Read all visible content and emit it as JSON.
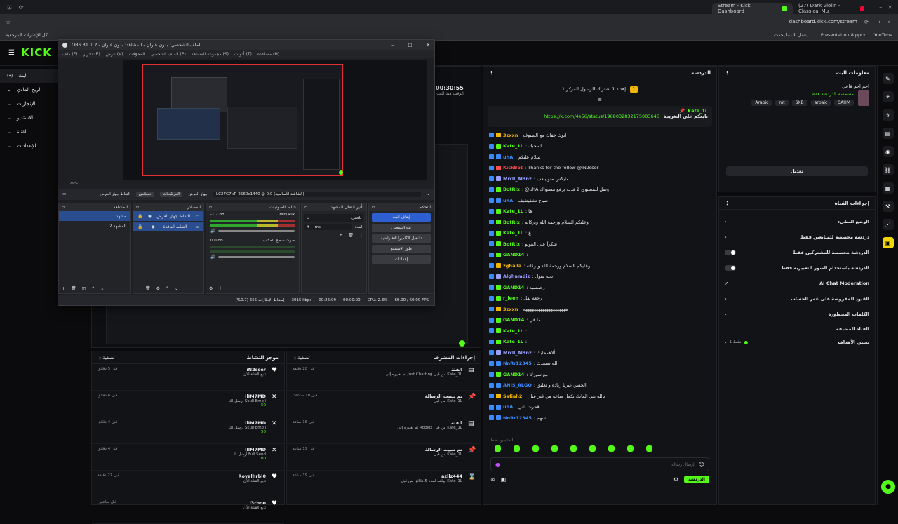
{
  "browser": {
    "tabs": [
      {
        "label": "Stream - Kick Dashboard",
        "active": true
      },
      {
        "label": "(27) Dark Violin - Classical Mu",
        "active": false
      }
    ],
    "url": "dashboard.kick.com/stream",
    "bookmarks": [
      "كل الإشارات المرجعية",
      "ينتقل لك ما يحدث...",
      "Presentation 8.pptx",
      "YouTube"
    ]
  },
  "kick": {
    "logo": "KICK",
    "nav": [
      {
        "label": "البث",
        "icon": "(•)",
        "active": true
      },
      {
        "label": "الربح المادي",
        "icon": "$"
      },
      {
        "label": "الإنجازات",
        "icon": "🏆"
      },
      {
        "label": "الاستديو",
        "icon": "✎"
      },
      {
        "label": "القناة",
        "icon": "✉"
      },
      {
        "label": "الإعدادات",
        "icon": "⚙"
      }
    ],
    "stream_timer": "00:30:55",
    "stream_timer_label": "الوقت منذ البث",
    "chat": {
      "title": "الدردشة",
      "pinned_banner": "إهداء 1 اشتراك للرسول المركز 1 ",
      "pinned_by": "Kate_1L",
      "pinned_text": "تابعكم على التغريدة",
      "pinned_link": "https://x.com/4e56/status/1968032832175083646",
      "messages": [
        {
          "user": "3zxxn",
          "color": "#f2b705",
          "text": ": ابوك خفاك مع الضيوف"
        },
        {
          "user": "Kate_1L",
          "color": "#53fc18",
          "text": ": اسحبك"
        },
        {
          "user": "uhA",
          "color": "#3a8bff",
          "text": ": سلام عليكم"
        },
        {
          "user": "KickBot",
          "color": "#ff4d4d",
          "text": ": Thanks for the follow @iN2sser"
        },
        {
          "user": "Mixll_Al3nz",
          "color": "#9aa0ff",
          "text": ": مايكس منو يلعب"
        },
        {
          "user": "BotRix",
          "color": "#53fc18",
          "text": ": @uhA وصل للمستوى 2 قدت برفع مستواك"
        },
        {
          "user": "uhA",
          "color": "#3a8bff",
          "text": ": صباح تشقيتقيف"
        },
        {
          "user": "Kate_1L",
          "color": "#53fc18",
          "text": ": ها"
        },
        {
          "user": "BotRix",
          "color": "#53fc18",
          "text": ": وعليكم السلام ورحمة الله وبركاته"
        },
        {
          "user": "Kate_1L",
          "color": "#53fc18",
          "text": ": غ!"
        },
        {
          "user": "BotRix",
          "color": "#53fc18",
          "text": ": شكراً على الفولو"
        },
        {
          "user": "GAND14",
          "color": "#53fc18",
          "text": ":"
        },
        {
          "user": "zghalla",
          "color": "#f2b705",
          "text": ": وعليكم السلام ورحمة الله وبركاته"
        },
        {
          "user": "Alghamdiz",
          "color": "#9aa0ff",
          "text": ": دنيه يقول"
        },
        {
          "user": "GAND14",
          "color": "#53fc18",
          "text": ": رحمسيه"
        },
        {
          "user": "r_leen",
          "color": "#53fc18",
          "text": ": رجعه يقل"
        },
        {
          "user": "3zxxn",
          "color": "#f2b705",
          "text": ": ههههههههههههههههههههه"
        },
        {
          "user": "GAND14",
          "color": "#53fc18",
          "text": ": ما في"
        },
        {
          "user": "Kate_1L",
          "color": "#53fc18",
          "text": ":"
        },
        {
          "user": "Kate_1L",
          "color": "#53fc18",
          "text": ":"
        },
        {
          "user": "Mixll_Al3nz",
          "color": "#9aa0ff",
          "text": ": ألاهمحابك"
        },
        {
          "user": "NnRr12345",
          "color": "#3a8bff",
          "text": ": الله يسعدك"
        },
        {
          "user": "GAND14",
          "color": "#53fc18",
          "text": ": مع سوزك"
        },
        {
          "user": "ANIS_ALGO",
          "color": "#3a8bff",
          "text": ": الحسن غيرنا زياده و تعليق"
        },
        {
          "user": "Safiah2",
          "color": "#f2b705",
          "text": ": بالله نبي المايك يكمل ساعه من غير عنال"
        },
        {
          "user": "uhA",
          "color": "#3a8bff",
          "text": ": قحرت اثني"
        },
        {
          "user": "NnRr12345",
          "color": "#3a8bff",
          "text": ": سهم"
        }
      ],
      "input_placeholder": "إرسال رسالة",
      "send_label": "الدردشة",
      "emote_label": "المتابعين فقط"
    },
    "stream_info": {
      "title": "معلومات البث",
      "stream_title": "احم احم قاعي",
      "category": "مسمسة الدردشة فقط",
      "tags": [
        "Arabic",
        "mt",
        "SXB",
        "arbaic",
        "SAHM"
      ],
      "edit_label": "تعديل"
    },
    "channel_actions": {
      "title": "إجراءات القناة",
      "items": [
        {
          "label": "الوضع البطيء",
          "control": "chevron"
        },
        {
          "label": "دردشة مخصصة للمتابعين فقط",
          "control": "chevron"
        },
        {
          "label": "الدردشة مخصصة للمشتركين فقط",
          "control": "toggle"
        },
        {
          "label": "الدردشة باستخدام الصور التعبيرية فقط",
          "control": "toggle"
        },
        {
          "label": "AI Chat Moderation",
          "control": "external"
        },
        {
          "label": "القيود المفروضة على عمر الحساب",
          "control": "chevron"
        },
        {
          "label": "الكلمات المحظورة",
          "control": "chevron"
        }
      ],
      "section2": "القناة المضيفة",
      "goal_label": "تعيين الأهداف",
      "goal_status": "نشط 1"
    },
    "activity": {
      "title": "موجز النشاط",
      "filter_label": "تصفية",
      "items": [
        {
          "icon": "♥",
          "user": "iN2sser",
          "desc": "تابع القناة الآن",
          "time": "قبل 5 دقائق"
        },
        {
          "icon": "✕",
          "user": "IlIM7MD",
          "desc": "أرسل لك Skull Emoji",
          "amount": "50",
          "time": "قبل 4 دقائق"
        },
        {
          "icon": "✕",
          "user": "IlIM7MD",
          "desc": "أرسل لك Skull Emoji",
          "amount": "50",
          "time": "قبل 4 دقائق"
        },
        {
          "icon": "✕",
          "user": "IlIM7MD",
          "desc": "أرسل لك Full Send",
          "amount": "100",
          "time": "قبل 4 دقائق"
        },
        {
          "icon": "♥",
          "user": "Royalhrbl0",
          "desc": "تابع القناة الآن",
          "time": "قبل 27 دقيقة"
        },
        {
          "icon": "♥",
          "user": "i3rboo",
          "desc": "تابع القناة الآن",
          "time": "قبل ساعتين"
        }
      ]
    },
    "mod_actions": {
      "title": "إجراءات المشرف",
      "filter_label": "تصفية",
      "items": [
        {
          "icon": "▤",
          "user": "الفئة",
          "desc": "تم تغييره إلى Just Chatting من قبل Kate_1L",
          "time": "قبل 28 دقيقة"
        },
        {
          "icon": "📌",
          "user": "تم تثبيت الرسالة",
          "desc": "من قبل Kate_1L",
          "time": "قبل 10 ساعات"
        },
        {
          "icon": "▤",
          "user": "الفئة",
          "desc": "تم تغييره إلى Roblox من قبل Kate_1L",
          "time": "قبل 18 ساعة"
        },
        {
          "icon": "📌",
          "user": "تم تثبيت الرسالة",
          "desc": "من قبل Kate_1L",
          "time": "قبل 19 ساعة"
        },
        {
          "icon": "⌛",
          "user": "azllz444",
          "desc": "أوقف لمدة 5 دقائق من قبل Kate_1L",
          "time": "قبل 19 ساعة"
        }
      ]
    }
  },
  "obs": {
    "title": "OBS 31.1.2 - الملف الشخصي: بدون عنوان - المشاهد: بدون عنوان",
    "menu": [
      "ملف (F)",
      "تحرير (E)",
      "عرض (V)",
      "المحوّلات",
      "الملف الشخصي (P)",
      "مجموعة المشاهد (S)",
      "أدوات (T)",
      "مساعدة (H)"
    ],
    "source_bar": {
      "source_label": "التقاط جهاز العرض",
      "props_label": "خصائص",
      "filters_label": "المرشّحات",
      "display_label": "جهاز العرض",
      "display_value": "LC27G7xT: 2560x1440 @ 0,0 (الشاشة الأساسية)"
    },
    "zoom": "29%",
    "scenes": {
      "title": "المشاهد",
      "items": [
        "مشهد",
        "المشهد 2"
      ]
    },
    "sources": {
      "title": "المصادر",
      "items": [
        "التقاط جهاز العرض",
        "التقاط النافذة"
      ]
    },
    "mixer": {
      "title": "خالط الصوتيات",
      "channels": [
        {
          "name": "Mic/Aux",
          "db": "-1.2 dB"
        },
        {
          "name": "صوت سطح المكتب",
          "db": "0.0 dB"
        }
      ]
    },
    "transitions": {
      "title": "تأثير انتقال المشهد",
      "type": "تلاشي",
      "duration_label": "المدة",
      "duration": "٣٠٠ ms"
    },
    "controls": {
      "title": "التحكم",
      "buttons": [
        "إيقاف البث",
        "بدء التسجيل",
        "تشغيل الكاميرا الافتراضية",
        "طور الاستديو",
        "إعدادات"
      ]
    },
    "status": {
      "frames": "إسقاط الإطارات 655 (0.7%)",
      "bitrate": "3015 kbps",
      "live_time": "00:26:09",
      "rec_time": "00:00:00",
      "cpu": "CPU: 2.3%",
      "fps": "60.00 / 60.00 FPS"
    }
  }
}
